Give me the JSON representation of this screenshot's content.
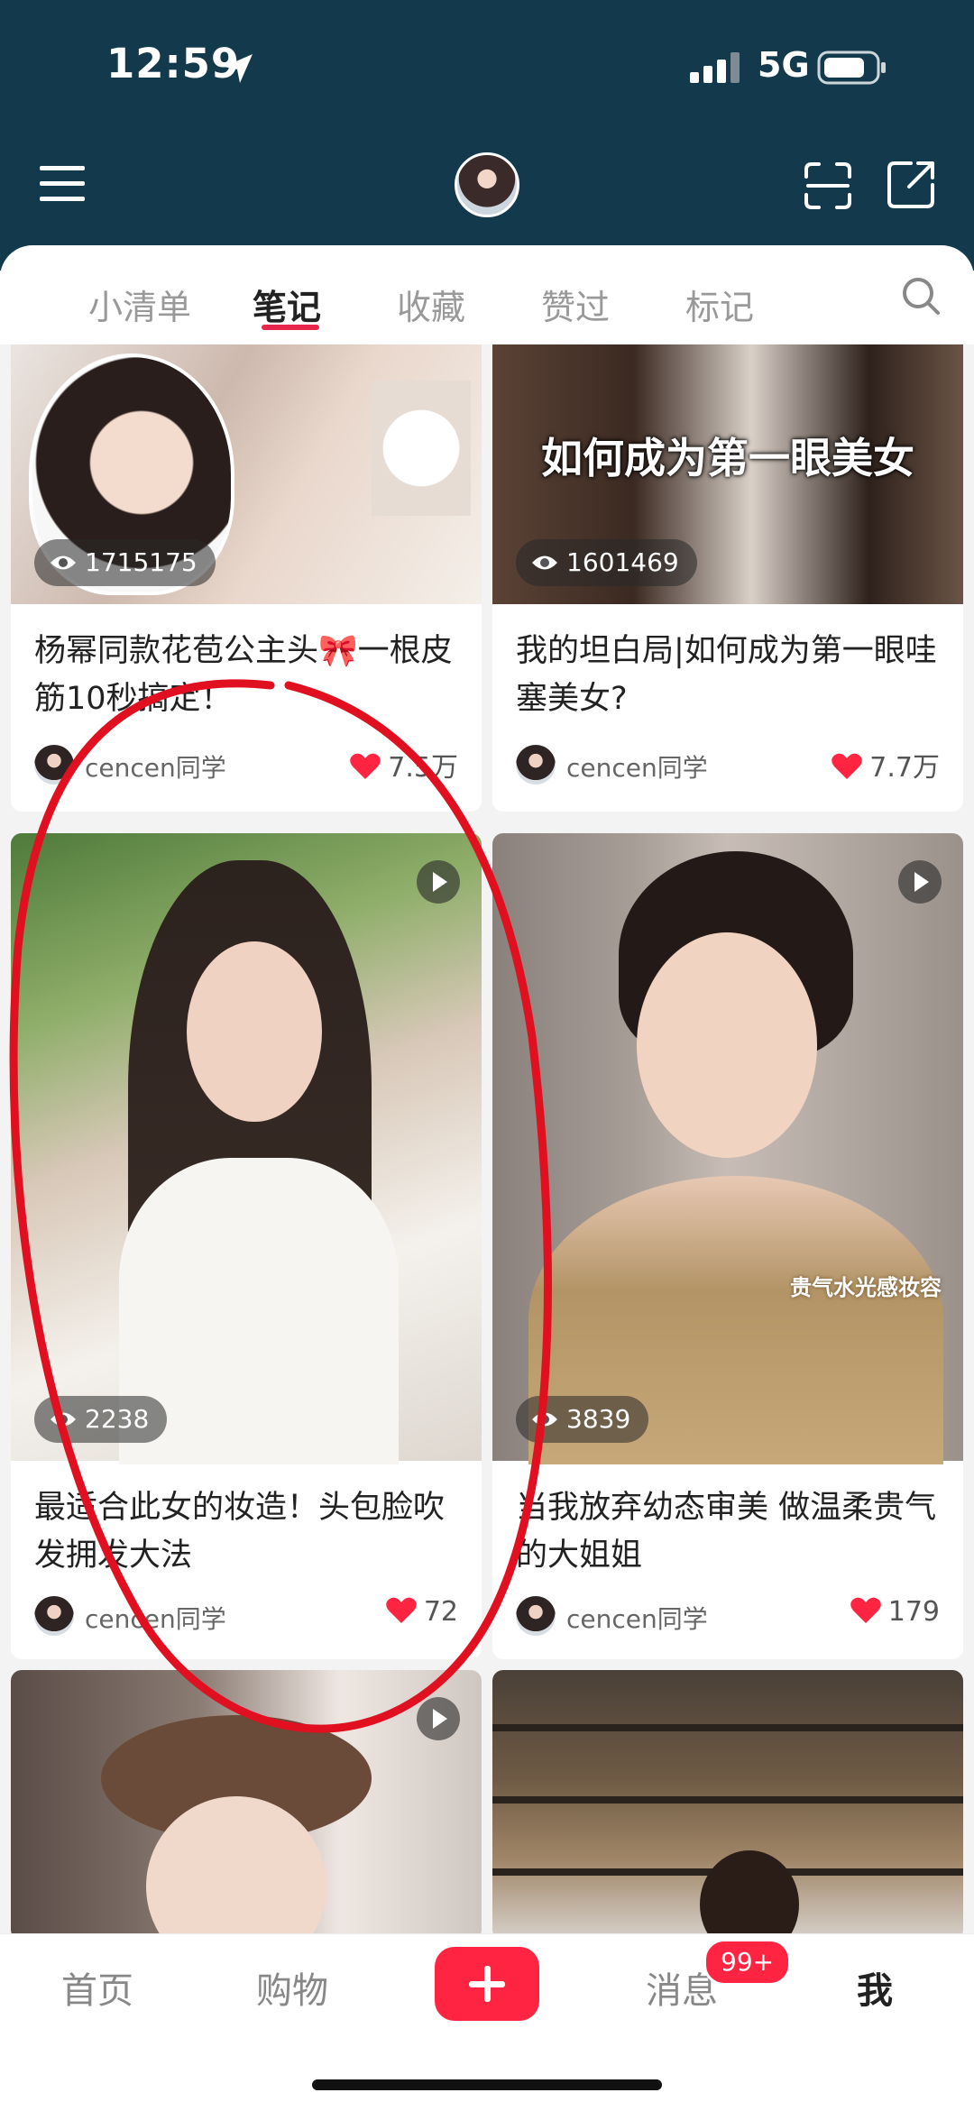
{
  "status_bar": {
    "time": "12:59",
    "network": "5G"
  },
  "header": {
    "icons": {
      "menu": "menu-icon",
      "scan": "scan-icon",
      "share": "share-icon"
    }
  },
  "tabs": [
    {
      "label": "小清单",
      "active": false
    },
    {
      "label": "笔记",
      "active": true
    },
    {
      "label": "收藏",
      "active": false
    },
    {
      "label": "赞过",
      "active": false
    },
    {
      "label": "标记",
      "active": false
    }
  ],
  "feed": {
    "cards": [
      {
        "views": "1715175",
        "caption": "杨幂同款花苞公主头🎀一根皮筋10秒搞定！",
        "author": "cencen同学",
        "likes": "7.5万"
      },
      {
        "views": "1601469",
        "cover_text": "如何成为第一眼美女",
        "caption": "我的坦白局|如何成为第一眼哇塞美女?",
        "author": "cencen同学",
        "likes": "7.7万"
      },
      {
        "views": "2238",
        "caption": "最适合此女的妆造！头包脸吹发拥发大法",
        "author": "cencen同学",
        "likes": "72"
      },
      {
        "views": "3839",
        "cover_text": "贵气水光感妆容",
        "caption": "当我放弃幼态审美 做温柔贵气的大姐姐",
        "author": "cencen同学",
        "likes": "179"
      }
    ]
  },
  "bottom_nav": {
    "items": [
      {
        "label": "首页",
        "active": false
      },
      {
        "label": "购物",
        "active": false
      },
      {
        "label": "消息",
        "active": false
      },
      {
        "label": "我",
        "active": true
      }
    ],
    "messages_badge": "99+"
  },
  "colors": {
    "header_bg": "#123a4c",
    "accent": "#ff2442",
    "tab_underline": "#e8254a"
  }
}
